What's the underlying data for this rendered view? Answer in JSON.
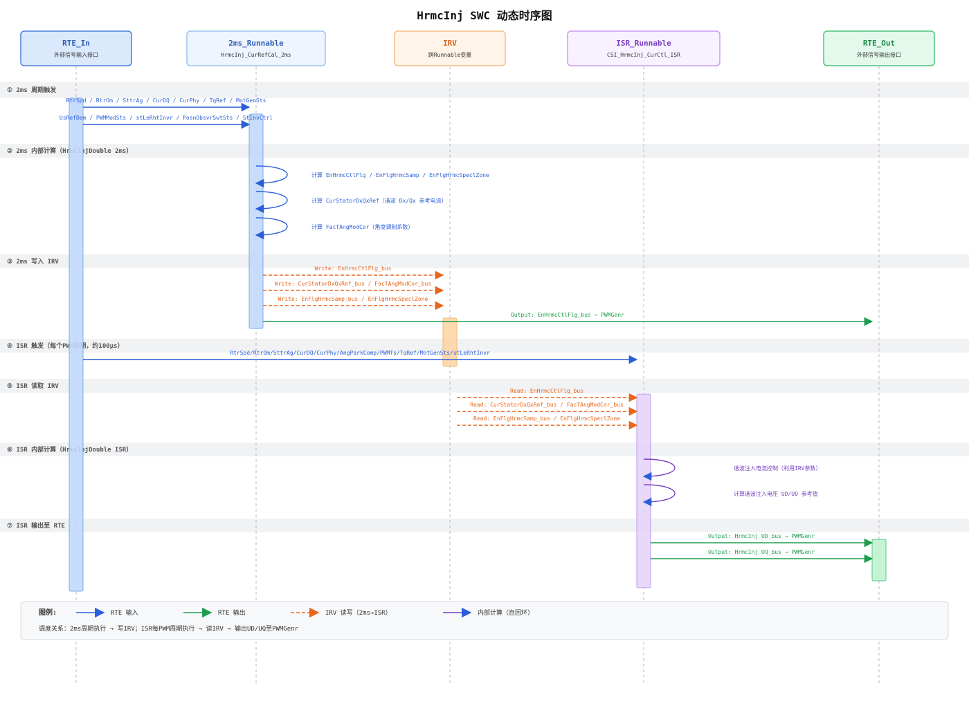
{
  "title": "HrmcInj SWC 动态时序图",
  "participants": [
    {
      "id": "rte_in",
      "name": "RTE_In",
      "sub": "外部信号输入接口",
      "color": "#2f5fb3",
      "fill": "#dbe9fd",
      "stroke": "#4a7fd8"
    },
    {
      "id": "r2ms",
      "name": "2ms_Runnable",
      "sub": "HrmcInj_CurRefCal_2ms",
      "color": "#2f5fb3",
      "fill": "#eef5ff",
      "stroke": "#9cc3ef"
    },
    {
      "id": "irv",
      "name": "IRV",
      "sub": "跨Runnable变量",
      "color": "#d9651b",
      "fill": "#fff4e8",
      "stroke": "#f4bd7f"
    },
    {
      "id": "isr",
      "name": "ISR_Runnable",
      "sub": "CSI_HrmcInj_CurCtl_ISR",
      "color": "#7b3fbf",
      "fill": "#f8f1ff",
      "stroke": "#cc9cf0"
    },
    {
      "id": "rte_out",
      "name": "RTE_Out",
      "sub": "外部信号输出接口",
      "color": "#1f8a4c",
      "fill": "#e3f9ec",
      "stroke": "#4cc47d"
    }
  ],
  "sections": [
    {
      "label": "① 2ms 周期触发"
    },
    {
      "label": "② 2ms 内部计算（HrmcInjDouble 2ms）"
    },
    {
      "label": "③ 2ms 写入 IRV"
    },
    {
      "label": "④ ISR 触发（每个PWM周期，约100μs）"
    },
    {
      "label": "⑤ ISR 读取 IRV"
    },
    {
      "label": "⑥ ISR 内部计算（HrmcInjDouble ISR）"
    },
    {
      "label": "⑦ ISR 输出至 RTE"
    }
  ],
  "messages": [
    {
      "kind": "rte_in",
      "from": "rte_in",
      "to": "r2ms",
      "text": "RtrSpd / RtrOm / SttrAg / CurDQ / CurPhy / TqRef / MotGenSts"
    },
    {
      "kind": "rte_in",
      "from": "rte_in",
      "to": "r2ms",
      "text": "UsRefDem / PWMModSts / stLeRhtInvr / PosnObsvrSwtSts / StInvCtrl"
    },
    {
      "kind": "self",
      "from": "r2ms",
      "to": "r2ms",
      "text": "计算 EnHrmcCtlFlg / EnFlgHrmcSamp / EnFlgHrmcSpeclZone"
    },
    {
      "kind": "self",
      "from": "r2ms",
      "to": "r2ms",
      "text": "计算 CurStatorDxQxRef（谐波 Dx/Qx 参考电流）"
    },
    {
      "kind": "self",
      "from": "r2ms",
      "to": "r2ms",
      "text": "计算 FacTAngModCor（角度调制系数）"
    },
    {
      "kind": "irv",
      "from": "r2ms",
      "to": "irv",
      "text": "Write: EnHrmcCtlFlg_bus"
    },
    {
      "kind": "irv",
      "from": "r2ms",
      "to": "irv",
      "text": "Write: CurStatorDxQxRef_bus / FacTAngModCor_bus"
    },
    {
      "kind": "irv",
      "from": "r2ms",
      "to": "irv",
      "text": "Write: EnFlgHrmcSamp_bus / EnFlgHrmcSpeclZone"
    },
    {
      "kind": "rte_out",
      "from": "r2ms",
      "to": "rte_out",
      "text": "Output: EnHrmcCtlFlg_bus → PWMGenr"
    },
    {
      "kind": "rte_in",
      "from": "rte_in",
      "to": "isr",
      "text": "RtrSpd/RtrOm/SttrAg/CurDQ/CurPhy/AngParkComp/PWMTs/TqRef/MotGenSts/stLeRhtInvr"
    },
    {
      "kind": "irv",
      "from": "irv",
      "to": "isr",
      "text": "Read: EnHrmcCtlFlg_bus"
    },
    {
      "kind": "irv",
      "from": "irv",
      "to": "isr",
      "text": "Read: CurStatorDxQxRef_bus / FacTAngModCor_bus"
    },
    {
      "kind": "irv",
      "from": "irv",
      "to": "isr",
      "text": "Read: EnFlgHrmcSamp_bus / EnFlgHrmcSpeclZone"
    },
    {
      "kind": "self",
      "from": "isr",
      "to": "isr",
      "text": "谐波注入电流控制（利用IRV参数）"
    },
    {
      "kind": "self",
      "from": "isr",
      "to": "isr",
      "text": "计算谐波注入电压 UD/UQ 参考值"
    },
    {
      "kind": "rte_out",
      "from": "isr",
      "to": "rte_out",
      "text": "Output: HrmcInj_UD_bus → PWMGenr"
    },
    {
      "kind": "rte_out",
      "from": "isr",
      "to": "rte_out",
      "text": "Output: HrmcInj_UQ_bus → PWMGenr"
    }
  ],
  "legend": {
    "title": "图例:",
    "items": [
      {
        "kind": "rte_in",
        "label": "RTE 输入"
      },
      {
        "kind": "rte_out",
        "label": "RTE 输出"
      },
      {
        "kind": "irv",
        "label": "IRV 读写（2ms→ISR）"
      },
      {
        "kind": "self_isr",
        "label": "内部计算（自回环）"
      }
    ],
    "note": "调度关系：2ms周期执行 → 写IRV；ISR每PWM周期执行 → 读IRV → 输出UD/UQ至PWMGenr"
  },
  "colors": {
    "rte_in": "#2b5fd9",
    "rte_out": "#1f9d4f",
    "irv": "#e8651a",
    "self_isr": "#7a3fc2",
    "section_bg": "#f1f2f4",
    "lifeline": "#bbbbbb"
  }
}
